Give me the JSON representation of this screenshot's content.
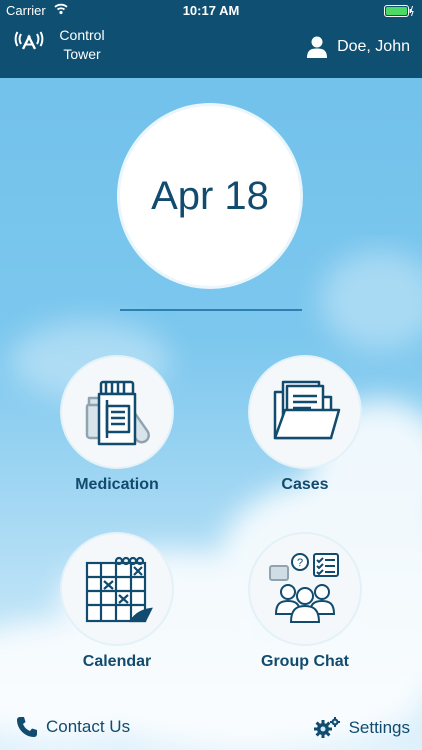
{
  "status_bar": {
    "carrier": "Carrier",
    "time": "10:17 AM"
  },
  "header": {
    "app_title": "Control Tower",
    "user_name": "Doe, John"
  },
  "date": {
    "display": "Apr 18"
  },
  "tiles": [
    {
      "label": "Medication",
      "icon": "medication-icon"
    },
    {
      "label": "Cases",
      "icon": "folder-icon"
    },
    {
      "label": "Calendar",
      "icon": "calendar-icon"
    },
    {
      "label": "Group Chat",
      "icon": "group-chat-icon"
    }
  ],
  "footer": {
    "contact_label": "Contact Us",
    "settings_label": "Settings"
  },
  "colors": {
    "header_bg": "#0f4f71",
    "text_dark": "#114b6e",
    "sky": "#7cc7ee"
  }
}
